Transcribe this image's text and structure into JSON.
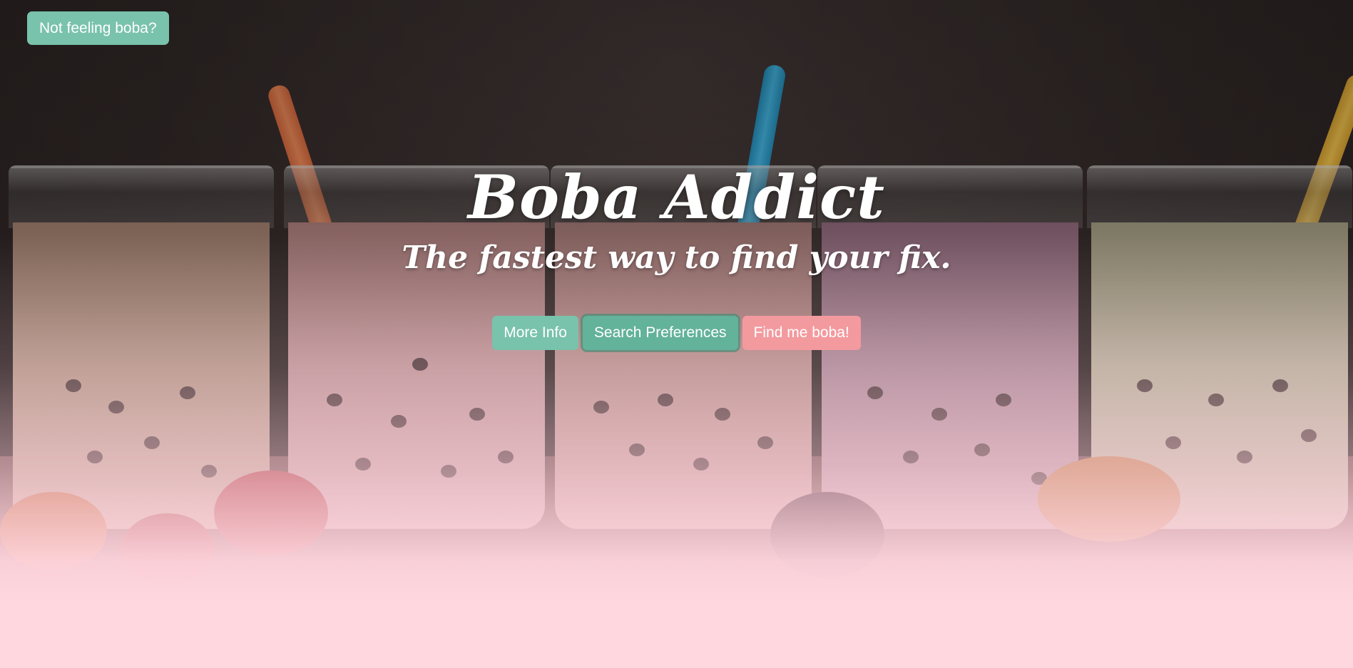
{
  "top_button": {
    "label": "Not feeling boba?"
  },
  "hero": {
    "title": "Boba Addict",
    "subtitle": "The fastest way to find your fix."
  },
  "actions": {
    "more_info_label": "More Info",
    "search_preferences_label": "Search Preferences",
    "find_boba_label": "Find me boba!"
  },
  "background": {
    "description_icon": "bubble-tea-glasses-photo",
    "overlay_color": "#ffd7df"
  },
  "colors": {
    "teal_accent": "#79c2ac",
    "pink_accent": "#f39a9f",
    "text": "#ffffff"
  }
}
